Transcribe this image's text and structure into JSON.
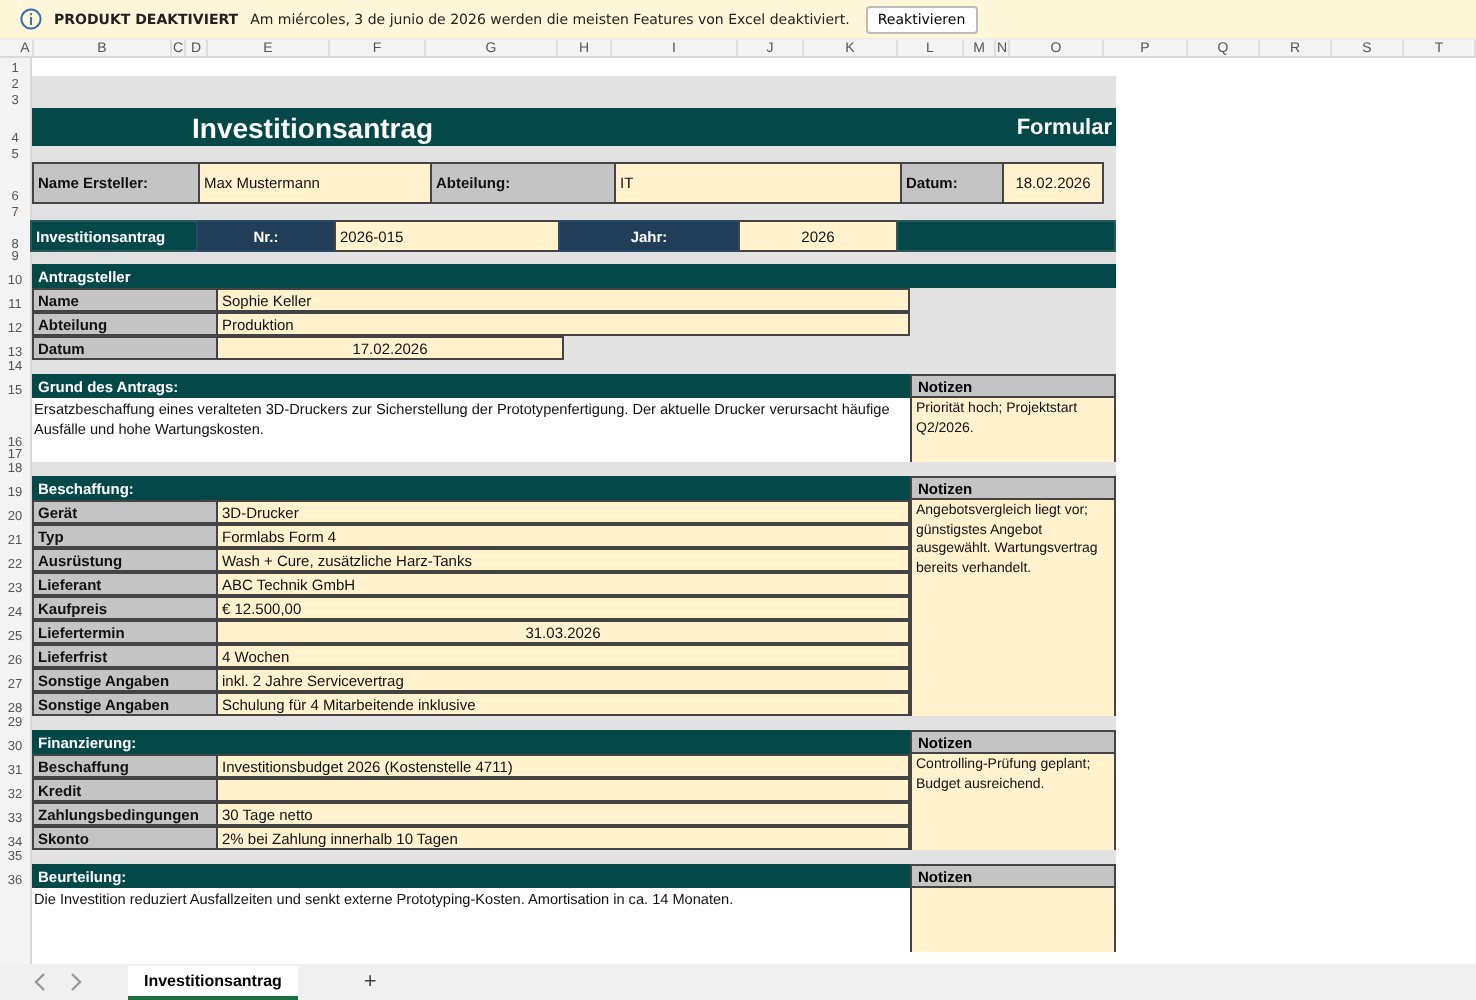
{
  "banner": {
    "title": "PRODUKT DEAKTIVIERT",
    "message": "Am miércoles, 3 de junio de 2026 werden die meisten Features von Excel deaktiviert.",
    "button": "Reaktivieren"
  },
  "column_headers": [
    "A",
    "B",
    "C",
    "D",
    "E",
    "F",
    "G",
    "H",
    "I",
    "J",
    "K",
    "L",
    "M",
    "N",
    "O",
    "P",
    "Q",
    "R",
    "S",
    "T"
  ],
  "row_numbers": [
    "1",
    "2",
    "3",
    "4",
    "5",
    "6",
    "7",
    "8",
    "9",
    "10",
    "11",
    "12",
    "13",
    "14",
    "15",
    "16",
    "17",
    "18",
    "19",
    "20",
    "21",
    "22",
    "23",
    "24",
    "25",
    "26",
    "27",
    "28",
    "29",
    "30",
    "31",
    "32",
    "33",
    "34",
    "35",
    "36"
  ],
  "title_bar": {
    "title": "Investitionsantrag",
    "subtitle": "Formular"
  },
  "header_fields": [
    {
      "label": "Name Ersteller:",
      "value": "Max Mustermann"
    },
    {
      "label": "Abteilung:",
      "value": "IT"
    },
    {
      "label": "Datum:",
      "value": "18.02.2026"
    }
  ],
  "request_bar": {
    "title": "Investitionsantrag",
    "number_label": "Nr.:",
    "number": "2026-015",
    "year_label": "Jahr:",
    "year": "2026"
  },
  "sections": [
    {
      "title": "Antragsteller",
      "kind": "fields",
      "fields": [
        {
          "label": "Name",
          "value": "Sophie Keller",
          "centered": false,
          "short": false
        },
        {
          "label": "Abteilung",
          "value": "Produktion",
          "centered": false,
          "short": false
        },
        {
          "label": "Datum",
          "value": "17.02.2026",
          "centered": true,
          "short": true
        }
      ]
    },
    {
      "title": "Grund des Antrags:",
      "kind": "text",
      "notes_label": "Notizen",
      "text": "Ersatzbeschaffung eines veralteten 3D-Druckers zur Sicherstellung der Prototypenfertigung. Der aktuelle Drucker verursacht häufige Ausfälle und hohe Wartungskosten.",
      "notes": "Priorität hoch; Projektstart Q2/2026."
    },
    {
      "title": "Beschaffung:",
      "kind": "fields",
      "notes_label": "Notizen",
      "notes": "Angebotsvergleich liegt vor; günstigstes Angebot ausgewählt. Wartungsvertrag bereits verhandelt.",
      "fields": [
        {
          "label": "Gerät",
          "value": "3D-Drucker",
          "centered": false,
          "short": false
        },
        {
          "label": "Typ",
          "value": "Formlabs Form 4",
          "centered": false,
          "short": false
        },
        {
          "label": "Ausrüstung",
          "value": "Wash + Cure, zusätzliche Harz-Tanks",
          "centered": false,
          "short": false
        },
        {
          "label": "Lieferant",
          "value": "ABC Technik GmbH",
          "centered": false,
          "short": false
        },
        {
          "label": "Kaufpreis",
          "value": "€ 12.500,00",
          "centered": false,
          "short": false
        },
        {
          "label": "Liefertermin",
          "value": "31.03.2026",
          "centered": true,
          "short": false
        },
        {
          "label": "Lieferfrist",
          "value": "4 Wochen",
          "centered": false,
          "short": false
        },
        {
          "label": "Sonstige Angaben",
          "value": "inkl. 2 Jahre Servicevertrag",
          "centered": false,
          "short": false
        },
        {
          "label": "Sonstige Angaben",
          "value": "Schulung für 4 Mitarbeitende inklusive",
          "centered": false,
          "short": false
        }
      ]
    },
    {
      "title": "Finanzierung:",
      "kind": "fields",
      "notes_label": "Notizen",
      "notes": "Controlling-Prüfung geplant; Budget ausreichend.",
      "fields": [
        {
          "label": "Beschaffung",
          "value": "Investitionsbudget 2026 (Kostenstelle 4711)",
          "centered": false,
          "short": false
        },
        {
          "label": "Kredit",
          "short": false
        },
        {
          "label": "Zahlungsbedingungen",
          "value": "30 Tage netto",
          "centered": false,
          "short": false
        },
        {
          "label": "Skonto",
          "value": "2% bei Zahlung innerhalb 10 Tagen",
          "centered": false,
          "short": false
        }
      ]
    },
    {
      "title": "Beurteilung:",
      "kind": "text",
      "notes_label": "Notizen",
      "text": "Die Investition reduziert Ausfallzeiten und senkt externe Prototyping-Kosten. Amortisation in ca. 14 Monaten."
    }
  ],
  "sheet_tabs": [
    {
      "label": "Investitionsantrag",
      "selected": true
    }
  ],
  "add_sheet": "+"
}
